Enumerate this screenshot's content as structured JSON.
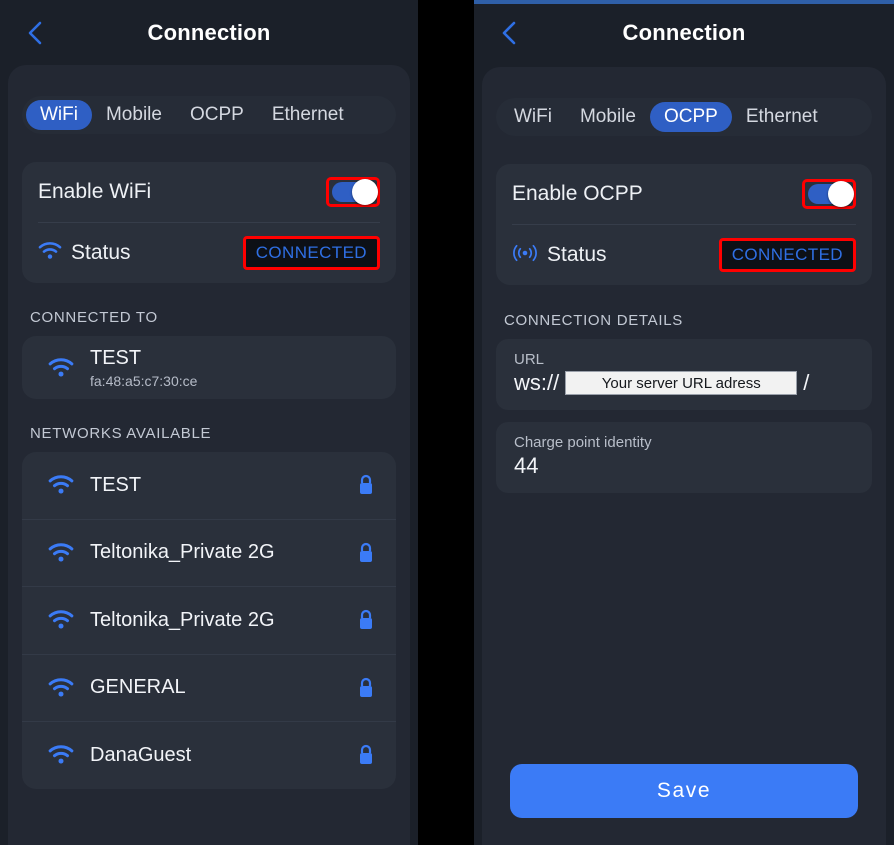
{
  "colors": {
    "accent_blue": "#2f5fc4",
    "save_blue": "#3b7bf6",
    "highlight_red": "#ff0000",
    "panel_bg": "#1b2029",
    "sheet_bg": "#232833",
    "card_bg": "#2a303b",
    "status_text": "#2f6fe4"
  },
  "left": {
    "header": {
      "title": "Connection",
      "back_icon": "chevron-left-icon"
    },
    "tabs": [
      {
        "label": "WiFi",
        "active": true
      },
      {
        "label": "Mobile",
        "active": false
      },
      {
        "label": "OCPP",
        "active": false
      },
      {
        "label": "Ethernet",
        "active": false
      }
    ],
    "enable": {
      "label": "Enable WiFi",
      "state": "on"
    },
    "status": {
      "icon": "wifi-icon",
      "label": "Status",
      "value": "CONNECTED"
    },
    "connected_to": {
      "section_label": "CONNECTED TO",
      "icon": "wifi-icon",
      "name": "TEST",
      "mac": "fa:48:a5:c7:30:ce"
    },
    "networks": {
      "section_label": "NETWORKS AVAILABLE",
      "items": [
        {
          "name": "TEST",
          "secured": true
        },
        {
          "name": "Teltonika_Private 2G",
          "secured": true
        },
        {
          "name": "Teltonika_Private 2G",
          "secured": true
        },
        {
          "name": "GENERAL",
          "secured": true
        },
        {
          "name": "DanaGuest",
          "secured": true
        }
      ]
    }
  },
  "right": {
    "header": {
      "title": "Connection",
      "back_icon": "chevron-left-icon"
    },
    "tabs": [
      {
        "label": "WiFi",
        "active": false
      },
      {
        "label": "Mobile",
        "active": false
      },
      {
        "label": "OCPP",
        "active": true
      },
      {
        "label": "Ethernet",
        "active": false
      }
    ],
    "enable": {
      "label": "Enable OCPP",
      "state": "on"
    },
    "status": {
      "icon": "broadcast-icon",
      "label": "Status",
      "value": "CONNECTED"
    },
    "details": {
      "section_label": "CONNECTION DETAILS",
      "url": {
        "label": "URL",
        "scheme": "ws://",
        "redacted_value": "Your server URL adress",
        "suffix": "/"
      },
      "charge_point": {
        "label": "Charge point identity",
        "value": "44"
      }
    },
    "save_label": "Save"
  }
}
